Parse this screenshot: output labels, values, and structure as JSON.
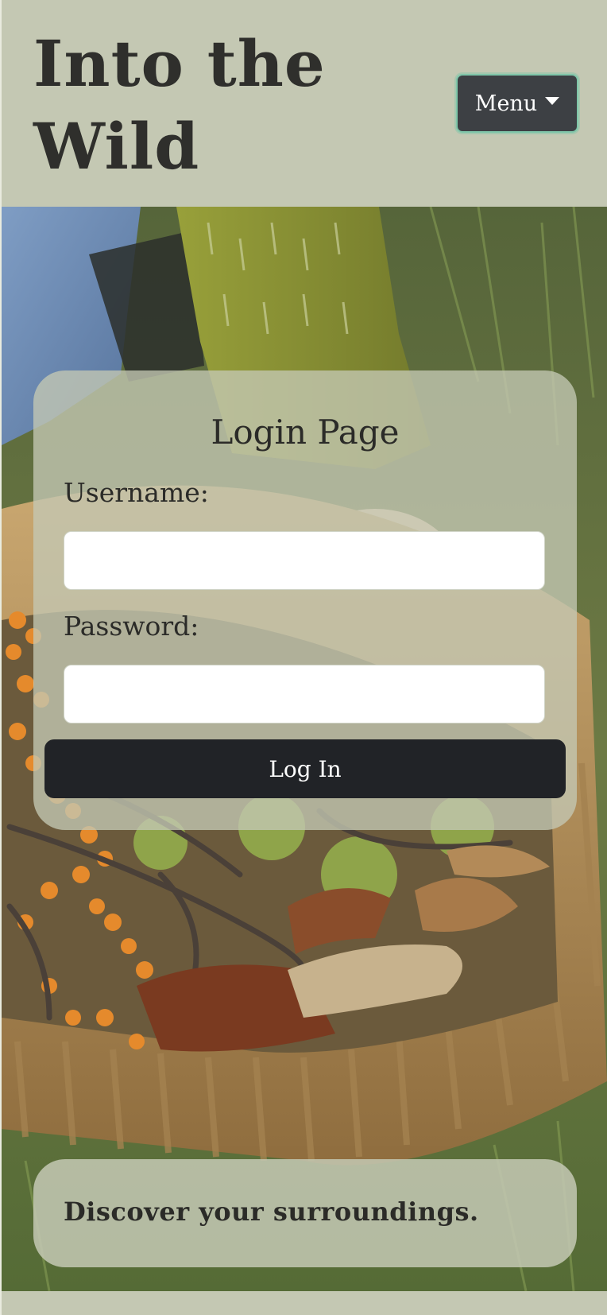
{
  "header": {
    "site_title": "Into the Wild",
    "menu_label": "Menu"
  },
  "login": {
    "heading": "Login Page",
    "username_label": "Username:",
    "username_value": "",
    "password_label": "Password:",
    "password_value": "",
    "submit_label": "Log In"
  },
  "tagline": {
    "text": "Discover your surroundings."
  },
  "colors": {
    "header_bg": "#c4c8b3",
    "menu_button_bg": "#3d4044",
    "menu_button_border": "#7fc6a9",
    "login_button_bg": "#212327",
    "text_dark": "#2b2b28"
  },
  "icons": {
    "menu_caret": "caret-down-icon"
  }
}
